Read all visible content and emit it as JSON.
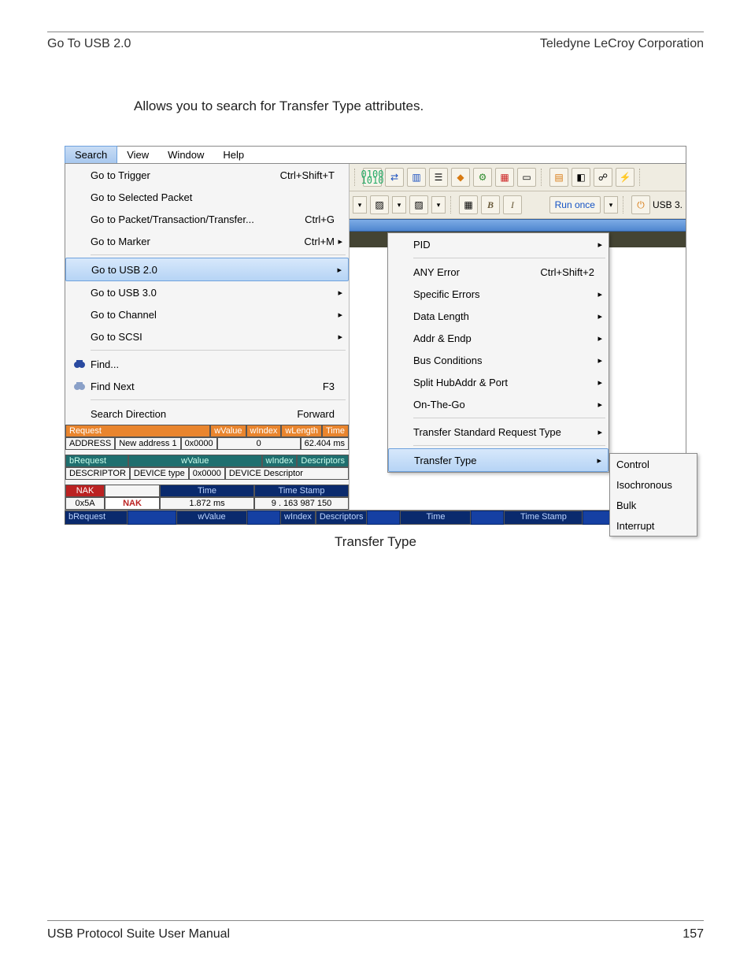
{
  "header": {
    "left": "Go To USB 2.0",
    "right": "Teledyne LeCroy Corporation"
  },
  "intro": "Allows you to search for Transfer Type attributes.",
  "menubar": {
    "items": [
      "Search",
      "View",
      "Window",
      "Help"
    ],
    "selected": 0
  },
  "search_menu": {
    "items": [
      {
        "label": "Go to Trigger",
        "accel": "Ctrl+Shift+T"
      },
      {
        "label": "Go to Selected Packet"
      },
      {
        "label": "Go to Packet/Transaction/Transfer...",
        "accel": "Ctrl+G"
      },
      {
        "label": "Go to Marker",
        "accel": "Ctrl+M",
        "arrow": true
      },
      {
        "sep": true
      },
      {
        "label": "Go to USB 2.0",
        "arrow": true,
        "hl": true
      },
      {
        "label": "Go to USB 3.0",
        "arrow": true
      },
      {
        "label": "Go to Channel",
        "arrow": true
      },
      {
        "label": "Go to SCSI",
        "arrow": true
      },
      {
        "sep": true
      },
      {
        "label": "Find...",
        "icon": "binoculars"
      },
      {
        "label": "Find Next",
        "accel": "F3",
        "icon": "binoculars-next"
      },
      {
        "sep": true
      },
      {
        "label": "Search Direction",
        "accel": "Forward"
      }
    ]
  },
  "submenu": {
    "items": [
      {
        "label": "PID",
        "arrow": true
      },
      {
        "sep": true
      },
      {
        "label": "ANY Error",
        "accel": "Ctrl+Shift+2"
      },
      {
        "label": "Specific Errors",
        "arrow": true
      },
      {
        "label": "Data Length",
        "arrow": true
      },
      {
        "label": "Addr & Endp",
        "arrow": true
      },
      {
        "label": "Bus Conditions",
        "arrow": true
      },
      {
        "label": "Split HubAddr & Port",
        "arrow": true
      },
      {
        "label": "On-The-Go",
        "arrow": true
      },
      {
        "sep": true
      },
      {
        "label": "Transfer Standard Request Type",
        "arrow": true
      },
      {
        "sep": true
      },
      {
        "label": "Transfer Type",
        "arrow": true,
        "hl": true
      }
    ]
  },
  "submenu2": {
    "items": [
      "Control",
      "Isochronous",
      "Bulk",
      "Interrupt"
    ]
  },
  "toolbar": {
    "row1_icons": [
      "binary",
      "swap",
      "bars",
      "list",
      "diamond",
      "config",
      "bus",
      "panel",
      "sheet",
      "tag",
      "link",
      "bolt"
    ],
    "row2_icons": [
      "hide-a",
      "hide-b",
      "grid",
      "bold-b",
      "italic-i"
    ],
    "run_once": "Run once",
    "usb3_label": "USB 3."
  },
  "trace": {
    "row_req": {
      "label": "Request",
      "c1": "wValue",
      "c2": "wIndex",
      "c3": "wLength",
      "c4": "Time"
    },
    "row_addr": {
      "c0": "ADDRESS",
      "c1": "New address 1",
      "c2": "0x0000",
      "c3": "0",
      "c4": "62.404 ms"
    },
    "row_breq": {
      "label": "bRequest",
      "c1": "wValue",
      "c2": "wIndex",
      "c3": "Descriptors"
    },
    "row_desc": {
      "c0": "DESCRIPTOR",
      "c1": "DEVICE type",
      "c2": "0x0000",
      "c3": "DEVICE Descriptor"
    },
    "row_nak_hdr": {
      "c0": "NAK",
      "c2": "Time",
      "c3": "Time Stamp"
    },
    "row_nak": {
      "c0": "0x5A",
      "c1": "NAK",
      "c2": "1.872 ms",
      "c3": "9 . 163 987 150"
    },
    "row_bottom": {
      "c0": "bRequest",
      "c1": "wValue",
      "c2": "wIndex",
      "c3": "Descriptors",
      "c4": "Time",
      "c5": "Time Stamp"
    }
  },
  "caption": "Transfer Type",
  "footer": {
    "left": "USB Protocol Suite User Manual",
    "right": "157"
  }
}
